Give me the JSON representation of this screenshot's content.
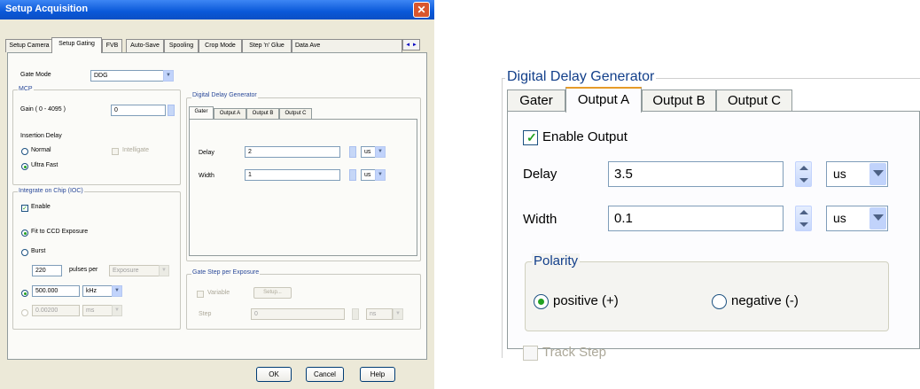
{
  "dialog": {
    "title": "Setup Acquisition",
    "close_glyph": "✕",
    "tabs": [
      "Setup Camera",
      "Setup Gating",
      "FVB",
      "Auto-Save",
      "Spooling",
      "Crop Mode",
      "Step 'n' Glue",
      "Data Ave"
    ],
    "active_tab": "Setup Gating",
    "tab_scroll": "◄ ►",
    "gate_mode": {
      "label": "Gate Mode",
      "value": "DDG"
    },
    "mcp": {
      "caption": "MCP",
      "gain_label": "Gain ( 0 - 4095 )",
      "gain_value": "0",
      "insertion_delay_label": "Insertion Delay",
      "normal_label": "Normal",
      "intelligate_label": "Intelligate",
      "ultra_fast_label": "Ultra Fast"
    },
    "ioc": {
      "caption": "Integrate on Chip (IOC)",
      "enable_label": "Enable",
      "fit_label": "Fit to CCD Exposure",
      "burst_label": "Burst",
      "pulses_value": "220",
      "pulses_label": "pulses per",
      "pulses_unit": "Exposure",
      "freq_value": "500.000",
      "freq_unit": "kHz",
      "period_value": "0.00200",
      "period_unit": "ms"
    },
    "ddg": {
      "caption": "Digital Delay Generator",
      "tabs": [
        "Gater",
        "Output A",
        "Output B",
        "Output C"
      ],
      "delay_label": "Delay",
      "delay_value": "2",
      "delay_unit": "us",
      "width_label": "Width",
      "width_value": "1",
      "width_unit": "us"
    },
    "gate_step": {
      "caption": "Gate Step per Exposure",
      "variable_label": "Variable",
      "setup_label": "Setup...",
      "step_label": "Step",
      "step_value": "0",
      "step_unit": "ns"
    },
    "buttons": {
      "ok": "OK",
      "cancel": "Cancel",
      "help": "Help"
    }
  },
  "zoom": {
    "caption": "Digital Delay Generator",
    "tabs": [
      "Gater",
      "Output A",
      "Output B",
      "Output C"
    ],
    "active_tab": "Output A",
    "enable_output_label": "Enable Output",
    "enable_output_checked": true,
    "delay_label": "Delay",
    "delay_value": "3.5",
    "delay_unit": "us",
    "width_label": "Width",
    "width_value": "0.1",
    "width_unit": "us",
    "polarity": {
      "caption": "Polarity",
      "positive_label": "positive (+)",
      "negative_label": "negative (-)",
      "selected": "positive"
    },
    "track_step_label": "Track Step"
  },
  "colors": {
    "title_bar": "#0a58d8",
    "dialog_bg": "#ece9d8",
    "active_tab_accent": "#e69b28",
    "check_green": "#21a121"
  },
  "icons": {
    "close": "close-icon",
    "spin": "spin-updown-icon",
    "dropdown": "chevron-down-icon"
  }
}
